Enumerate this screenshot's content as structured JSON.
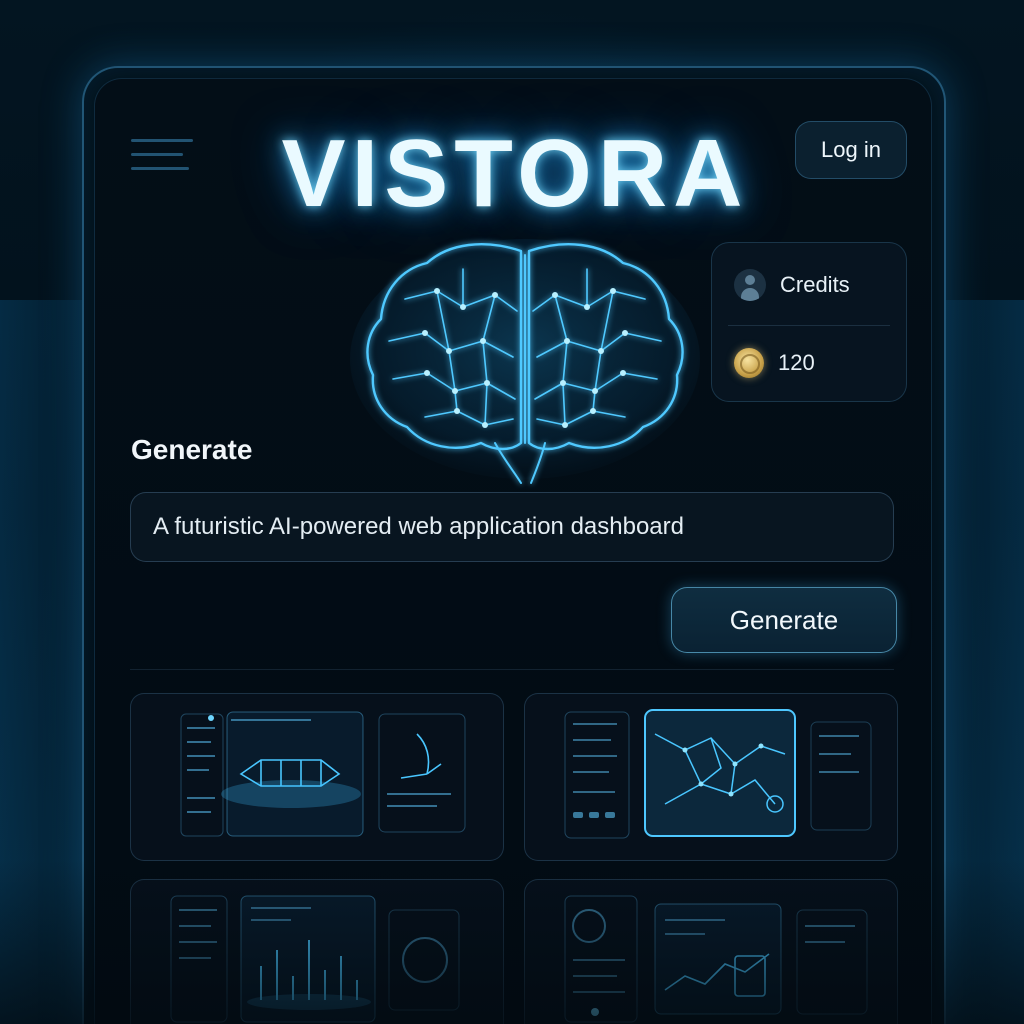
{
  "app": {
    "brand": "VISTORA"
  },
  "header": {
    "login_label": "Log in"
  },
  "credits": {
    "label": "Credits",
    "amount": "120"
  },
  "generate": {
    "section_title": "Generate",
    "prompt_value": "A futuristic AI-powered web application dashboard",
    "button_label": "Generate"
  },
  "gallery": {
    "count_visible": 4
  },
  "icons": {
    "menu": "hamburger-icon",
    "user": "user-avatar-icon",
    "coin": "coin-icon",
    "hero": "brain-icon"
  },
  "colors": {
    "accent": "#3fb8f0",
    "background": "#020b13",
    "coin": "#d8b35a"
  }
}
